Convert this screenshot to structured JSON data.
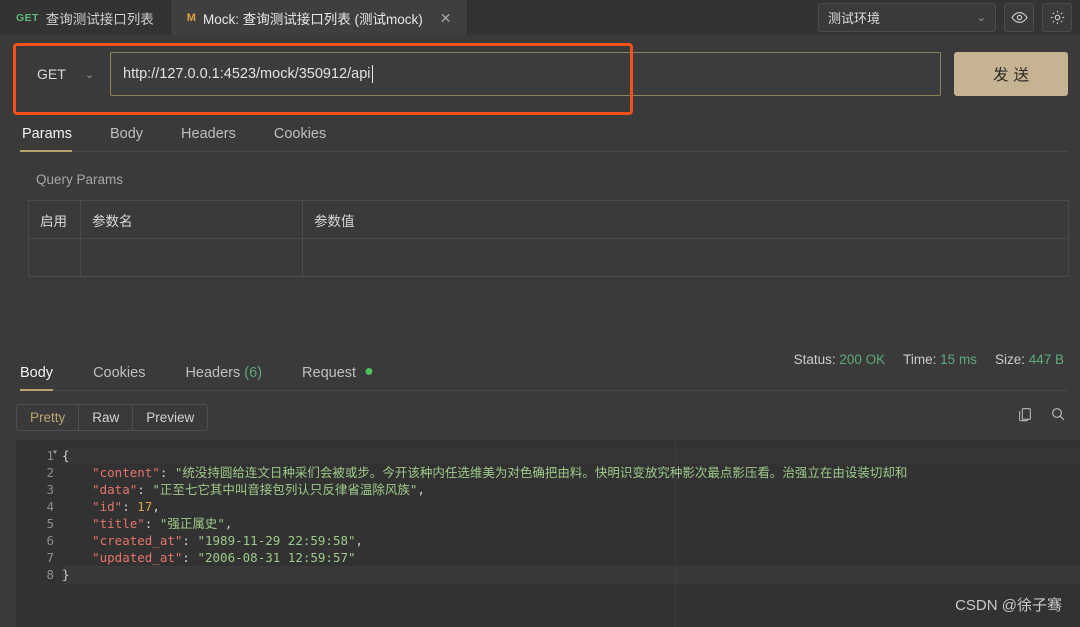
{
  "window": {
    "tabs": [
      {
        "method": "GET",
        "title": "查询测试接口列表",
        "active": false,
        "closable": false
      },
      {
        "method": "M",
        "title": "Mock: 查询测试接口列表 (测试mock)",
        "active": true,
        "closable": true,
        "close_label": "✕"
      }
    ],
    "environment": {
      "value": "测试环境",
      "chevron": "⌄"
    },
    "eye_icon": "eye-icon",
    "settings_icon": "gear-icon"
  },
  "request": {
    "method": "GET",
    "method_chevron": "⌄",
    "url": "http://127.0.0.1:4523/mock/350912/api",
    "send_label": "发送",
    "highlight_color": "#f2511b",
    "tabs": [
      {
        "label": "Params",
        "selected": true
      },
      {
        "label": "Body",
        "selected": false
      },
      {
        "label": "Headers",
        "selected": false
      },
      {
        "label": "Cookies",
        "selected": false
      }
    ],
    "query_params_label": "Query Params",
    "params_table": {
      "headers": [
        "启用",
        "参数名",
        "参数值"
      ],
      "rows": [
        [
          "",
          "",
          ""
        ]
      ]
    }
  },
  "response": {
    "tabs": [
      {
        "label": "Body",
        "selected": true,
        "count": "",
        "dot": false
      },
      {
        "label": "Cookies",
        "selected": false,
        "count": "",
        "dot": false
      },
      {
        "label": "Headers",
        "selected": false,
        "count": "(6)",
        "dot": false
      },
      {
        "label": "Request",
        "selected": false,
        "count": "",
        "dot": true
      }
    ],
    "status": {
      "label": "Status:",
      "value": "200 OK"
    },
    "time": {
      "label": "Time:",
      "value": "15 ms"
    },
    "size": {
      "label": "Size:",
      "value": "447 B"
    },
    "view_modes": [
      {
        "label": "Pretty",
        "selected": true
      },
      {
        "label": "Raw",
        "selected": false
      },
      {
        "label": "Preview",
        "selected": false
      }
    ],
    "tools": [
      {
        "name": "copy-icon"
      },
      {
        "name": "search-icon"
      }
    ],
    "body": {
      "line_numbers": [
        "1",
        "2",
        "3",
        "4",
        "5",
        "6",
        "7",
        "8"
      ],
      "fold_marker": "▾",
      "lines": [
        {
          "open_brace": "{"
        },
        {
          "key": "\"content\"",
          "colon": ": ",
          "value": "\"统没持圆给连文日种采们会被或步。今开该种内任选维美为对色确把由料。快明识变放究种影次最点影压看。治强立在由设装切却和",
          "comma": ""
        },
        {
          "key": "\"data\"",
          "colon": ": ",
          "value": "\"正至七它其中叫音接包列认只反律省温除风族\"",
          "comma": ","
        },
        {
          "key": "\"id\"",
          "colon": ": ",
          "number": "17",
          "comma": ","
        },
        {
          "key": "\"title\"",
          "colon": ": ",
          "value": "\"强正属史\"",
          "comma": ","
        },
        {
          "key": "\"created_at\"",
          "colon": ": ",
          "value": "\"1989-11-29 22:59:58\"",
          "comma": ","
        },
        {
          "key": "\"updated_at\"",
          "colon": ": ",
          "value": "\"2006-08-31 12:59:57\"",
          "comma": ""
        },
        {
          "close_brace": "}"
        }
      ]
    }
  },
  "watermark": "CSDN @徐子骞"
}
